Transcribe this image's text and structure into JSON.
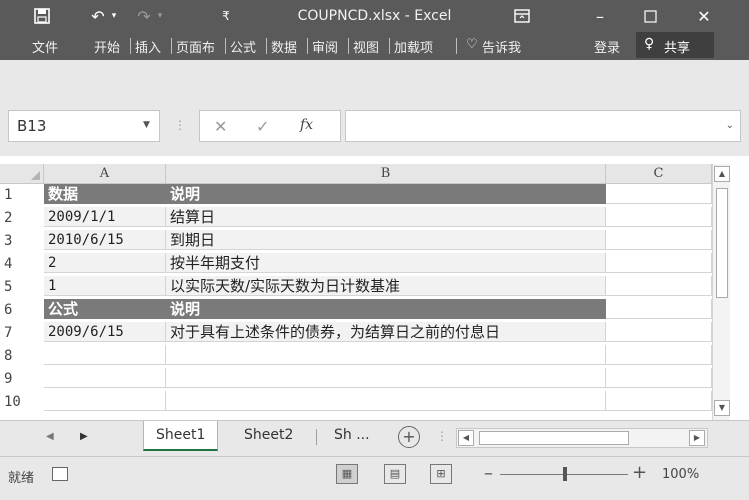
{
  "window": {
    "title": "COUPNCD.xlsx - Excel",
    "menu": [
      "文件",
      "开始",
      "插入",
      "页面布",
      "公式",
      "数据",
      "审阅",
      "视图",
      "加载项"
    ],
    "tell_me": "告诉我",
    "login": "登录",
    "share": "共享"
  },
  "formula_bar": {
    "name_box": "B13",
    "formula": ""
  },
  "columns": [
    "A",
    "B",
    "C"
  ],
  "rows": [
    {
      "num": "1",
      "a": "数据",
      "b": "说明",
      "header": true
    },
    {
      "num": "2",
      "a": "2009/1/1",
      "b": "结算日",
      "header": false
    },
    {
      "num": "3",
      "a": "2010/6/15",
      "b": "到期日",
      "header": false
    },
    {
      "num": "4",
      "a": "2",
      "b": "按半年期支付",
      "header": false
    },
    {
      "num": "5",
      "a": "1",
      "b": "以实际天数/实际天数为日计数基准",
      "header": false
    },
    {
      "num": "6",
      "a": "公式",
      "b": "说明",
      "header": true
    },
    {
      "num": "7",
      "a": "2009/6/15",
      "b": "对于具有上述条件的债券，为结算日之前的付息日",
      "header": false
    },
    {
      "num": "8",
      "a": "",
      "b": "",
      "header": false
    },
    {
      "num": "9",
      "a": "",
      "b": "",
      "header": false
    },
    {
      "num": "10",
      "a": "",
      "b": "",
      "header": false
    }
  ],
  "sheets": [
    "Sheet1",
    "Sheet2",
    "Sh ..."
  ],
  "active_sheet": "Sheet1",
  "status": {
    "ready": "就绪",
    "zoom": "100%"
  },
  "colors": {
    "titlebar": "#5a5a5a",
    "header_row": "#7a7a7a",
    "shaded": "#f2f2f2",
    "accent": "#217346"
  }
}
